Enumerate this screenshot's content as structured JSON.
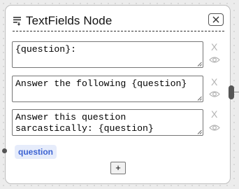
{
  "node": {
    "title": "TextFields Node",
    "fields": [
      {
        "value": "{question}:"
      },
      {
        "value": "Answer the following {question}"
      },
      {
        "value": "Answer this question sarcastically: {question}"
      }
    ],
    "remove_label": "X",
    "variable_tag": "question",
    "add_label": "+"
  },
  "icons": {
    "header": "text-lines-icon",
    "close": "close-icon",
    "remove": "remove-x-icon",
    "visibility": "eye-icon"
  },
  "colors": {
    "tag_background": "#e6ecfb",
    "tag_text": "#3d63d2",
    "muted_icon": "#b3b3b3"
  }
}
